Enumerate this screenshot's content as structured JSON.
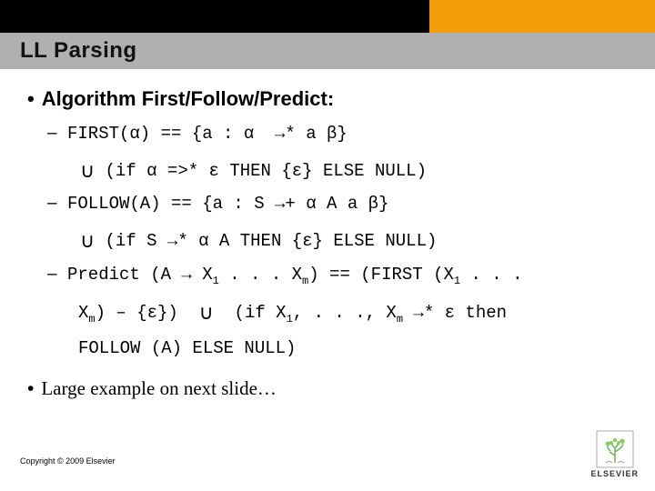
{
  "header": {
    "title": "LL Parsing"
  },
  "main": {
    "heading": "Algorithm First/Follow/Predict:",
    "first_l1": "FIRST(α) == {a : α  →* a β}",
    "first_l2_pre": "(if α =>* ε THEN {ε} ELSE NULL)",
    "follow_l1": "FOLLOW(A) == {a : S →+ α A a β}",
    "follow_l2_pre": "(if S →* α A THEN {ε} ELSE NULL)",
    "predict_l1a": "Predict (A → X",
    "predict_l1b": " . . . X",
    "predict_l1c": ") == (FIRST (X",
    "predict_l1d": " . . .",
    "predict_l2a": "X",
    "predict_l2b": ") – {ε})  ",
    "predict_l2c": "  (if X",
    "predict_l2d": ", . . ., X",
    "predict_l2e": " →* ε then",
    "predict_l3": "FOLLOW (A) ELSE NULL)",
    "footer_bullet": "Large example on next slide…"
  },
  "footer": {
    "copyright": "Copyright © 2009 Elsevier",
    "publisher": "ELSEVIER"
  },
  "symbols": {
    "union": "∪",
    "dash": "–",
    "bullet": "•"
  },
  "sub": {
    "one": "1",
    "m": "m"
  }
}
